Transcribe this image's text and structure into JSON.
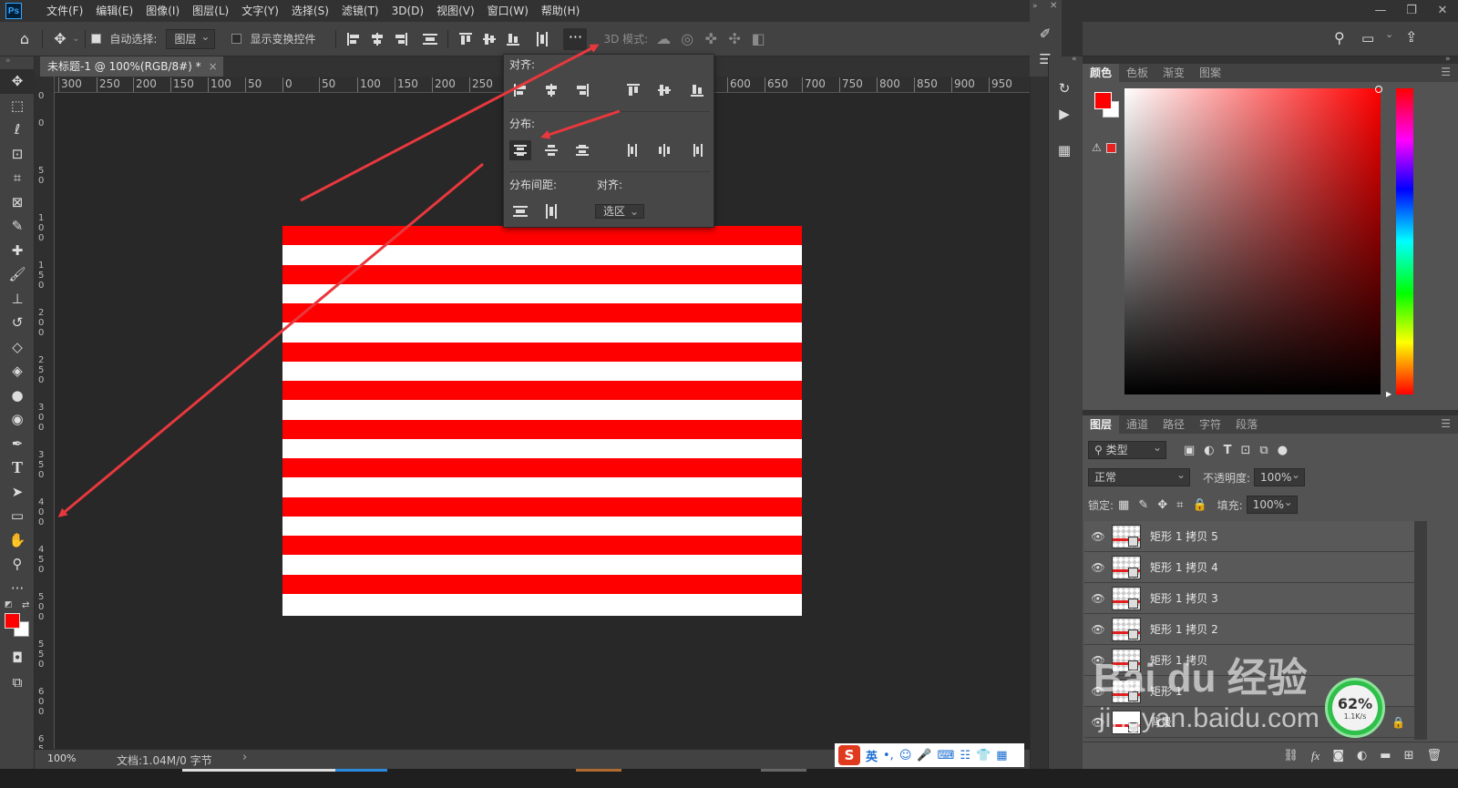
{
  "app": {
    "logo": "Ps"
  },
  "menu": [
    "文件(F)",
    "编辑(E)",
    "图像(I)",
    "图层(L)",
    "文字(Y)",
    "选择(S)",
    "滤镜(T)",
    "3D(D)",
    "视图(V)",
    "窗口(W)",
    "帮助(H)"
  ],
  "options": {
    "auto_select_label": "自动选择:",
    "auto_select_target": "图层",
    "show_transform_label": "显示变换控件",
    "more_label": "···",
    "mode_3d_label": "3D 模式:"
  },
  "document": {
    "tab_title": "未标题-1 @ 100%(RGB/8#) *",
    "zoom": "100%",
    "doc_info": "文档:1.04M/0 字节",
    "stripe_color": "#ff0000",
    "stripe_count": 10
  },
  "ruler": {
    "h_labels": [
      "300",
      "250",
      "200",
      "150",
      "100",
      "50",
      "0",
      "50",
      "100",
      "150",
      "200",
      "250",
      "600",
      "650",
      "700",
      "750",
      "800",
      "850",
      "900",
      "950"
    ],
    "v_labels": [
      "0",
      "0",
      "50",
      "100",
      "150",
      "200",
      "250",
      "300",
      "350",
      "400",
      "450",
      "500",
      "550",
      "600",
      "650"
    ]
  },
  "align_panel": {
    "align_label": "对齐:",
    "distribute_label": "分布:",
    "spacing_label": "分布间距:",
    "align_to_label": "对齐:",
    "align_to_value": "选区"
  },
  "color_panel": {
    "tabs": [
      "颜色",
      "色板",
      "渐变",
      "图案"
    ],
    "foreground": "#ff0000",
    "background": "#ffffff"
  },
  "layers_panel": {
    "tabs": [
      "图层",
      "通道",
      "路径",
      "字符",
      "段落"
    ],
    "filter_label": "类型",
    "blend_mode": "正常",
    "opacity_label": "不透明度:",
    "opacity_value": "100%",
    "lock_label": "锁定:",
    "fill_label": "填充:",
    "fill_value": "100%",
    "layers": [
      "矩形 1 拷贝 5",
      "矩形 1 拷贝 4",
      "矩形 1 拷贝 3",
      "矩形 1 拷贝 2",
      "矩形 1 拷贝",
      "矩形 1",
      "背景"
    ]
  },
  "ime": {
    "lang": "英"
  },
  "watermark": {
    "logo": "Bai du 经验",
    "url": "jingyan.baidu.com"
  },
  "network_badge": {
    "percent": "62%",
    "speed": "1.1K/s"
  },
  "accent_colors": {
    "arrow": "#e8383d",
    "ps_blue": "#31a8ff"
  }
}
